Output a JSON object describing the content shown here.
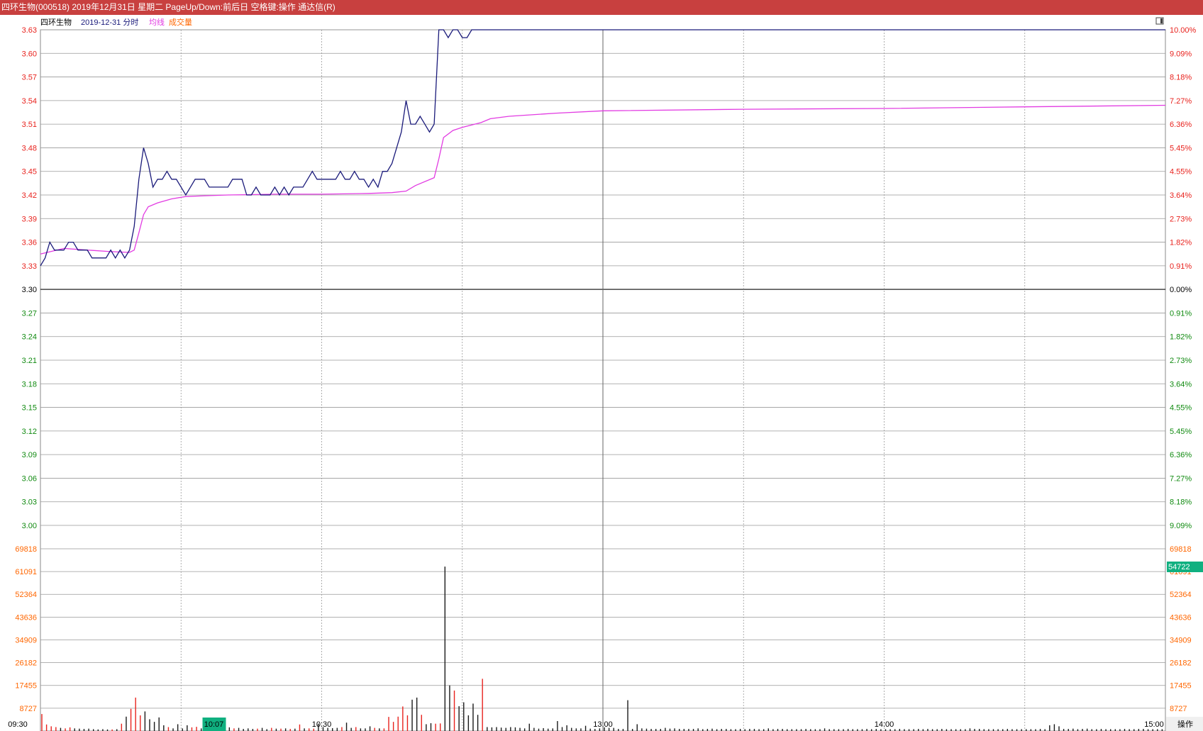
{
  "window": {
    "title": "四环生物(000518) 2019年12月31日 星期二 PageUp/Down:前后日 空格键:操作 通达信(R)"
  },
  "header": {
    "stock_name": "四环生物",
    "date_label": "2019-12-31 分时",
    "avg_label": "均线",
    "vol_label": "成交量"
  },
  "colors": {
    "up": "#e8221d",
    "down": "#108a10",
    "price_line": "#1a1a7a",
    "avg_line": "#e23be2",
    "volume_label": "#ff6600",
    "badge": "#10b080",
    "titlebar": "#c8403f"
  },
  "buttons": {
    "operate": "操作",
    "corner_icon": "window-toggle-icon"
  },
  "chart_data": {
    "type": "line",
    "title": "四环生物(000518) 2019-12-31 分时",
    "prev_close": 3.3,
    "price_axis": {
      "ylim": [
        3.0,
        3.63
      ],
      "ticks": [
        "3.63",
        "3.60",
        "3.57",
        "3.54",
        "3.51",
        "3.48",
        "3.45",
        "3.42",
        "3.39",
        "3.36",
        "3.33",
        "3.30",
        "3.27",
        "3.24",
        "3.21",
        "3.18",
        "3.15",
        "3.12",
        "3.09",
        "3.06",
        "3.03",
        "3.00"
      ],
      "pct_ticks": [
        "10.00%",
        "9.09%",
        "8.18%",
        "7.27%",
        "6.36%",
        "5.45%",
        "4.55%",
        "3.64%",
        "2.73%",
        "1.82%",
        "0.91%",
        "0.00%",
        "0.91%",
        "1.82%",
        "2.73%",
        "3.64%",
        "4.55%",
        "5.45%",
        "6.36%",
        "7.27%",
        "8.18%",
        "9.09%"
      ]
    },
    "volume_axis": {
      "ylim": [
        0,
        69818
      ],
      "ticks": [
        "69818",
        "61091",
        "52364",
        "43636",
        "34909",
        "26182",
        "17455",
        "8727"
      ],
      "highlight": "54722"
    },
    "x_axis": {
      "ticks": [
        "09:30",
        "10:30",
        "13:00",
        "14:00",
        "15:00"
      ],
      "cursor_label": "10:07"
    },
    "series": [
      {
        "name": "分时",
        "x": [
          0,
          1,
          2,
          3,
          4,
          5,
          6,
          7,
          8,
          9,
          10,
          11,
          12,
          13,
          14,
          15,
          16,
          17,
          18,
          19,
          20,
          21,
          22,
          23,
          24,
          25,
          26,
          27,
          28,
          29,
          30,
          31,
          32,
          33,
          34,
          35,
          36,
          37,
          38,
          39,
          40,
          41,
          42,
          43,
          44,
          45,
          46,
          47,
          48,
          49,
          50,
          51,
          52,
          53,
          54,
          55,
          56,
          57,
          58,
          59,
          60,
          61,
          62,
          63,
          64,
          65,
          66,
          67,
          68,
          69,
          70,
          71,
          72,
          73,
          74,
          75,
          76,
          77,
          78,
          79,
          80,
          81,
          82,
          83,
          84,
          85,
          86,
          87,
          88,
          89,
          90,
          91,
          92,
          93,
          94,
          95,
          96,
          97,
          98,
          99,
          100,
          101,
          240
        ],
        "values": [
          3.33,
          3.34,
          3.36,
          3.35,
          3.35,
          3.35,
          3.36,
          3.36,
          3.35,
          3.35,
          3.35,
          3.34,
          3.34,
          3.34,
          3.34,
          3.35,
          3.34,
          3.35,
          3.34,
          3.35,
          3.38,
          3.44,
          3.48,
          3.46,
          3.43,
          3.44,
          3.44,
          3.45,
          3.44,
          3.44,
          3.43,
          3.42,
          3.43,
          3.44,
          3.44,
          3.44,
          3.43,
          3.43,
          3.43,
          3.43,
          3.43,
          3.44,
          3.44,
          3.44,
          3.42,
          3.42,
          3.43,
          3.42,
          3.42,
          3.42,
          3.43,
          3.42,
          3.43,
          3.42,
          3.43,
          3.43,
          3.43,
          3.44,
          3.45,
          3.44,
          3.44,
          3.44,
          3.44,
          3.44,
          3.45,
          3.44,
          3.44,
          3.45,
          3.44,
          3.44,
          3.43,
          3.44,
          3.43,
          3.45,
          3.45,
          3.46,
          3.48,
          3.5,
          3.54,
          3.51,
          3.51,
          3.52,
          3.51,
          3.5,
          3.51,
          3.63,
          3.63,
          3.62,
          3.63,
          3.63,
          3.62,
          3.62,
          3.63,
          3.63,
          3.63,
          3.63,
          3.63,
          3.63,
          3.63,
          3.63,
          3.63,
          3.63,
          3.63
        ]
      },
      {
        "name": "均线",
        "x": [
          0,
          5,
          10,
          15,
          19,
          20,
          21,
          22,
          23,
          25,
          28,
          31,
          35,
          40,
          50,
          60,
          70,
          75,
          78,
          80,
          84,
          85,
          86,
          88,
          90,
          92,
          94,
          96,
          100,
          110,
          120,
          150,
          180,
          210,
          240
        ],
        "values": [
          3.345,
          3.352,
          3.35,
          3.348,
          3.347,
          3.35,
          3.372,
          3.395,
          3.405,
          3.41,
          3.415,
          3.418,
          3.419,
          3.42,
          3.421,
          3.421,
          3.422,
          3.423,
          3.425,
          3.432,
          3.442,
          3.466,
          3.493,
          3.502,
          3.506,
          3.509,
          3.512,
          3.517,
          3.52,
          3.524,
          3.527,
          3.529,
          3.53,
          3.532,
          3.534
        ]
      }
    ],
    "volume": {
      "x": [
        0,
        1,
        2,
        3,
        4,
        5,
        6,
        7,
        8,
        9,
        10,
        11,
        12,
        13,
        14,
        15,
        16,
        17,
        18,
        19,
        20,
        21,
        22,
        23,
        24,
        25,
        26,
        27,
        28,
        29,
        30,
        31,
        32,
        33,
        34,
        35,
        36,
        37,
        38,
        39,
        40,
        41,
        42,
        43,
        44,
        45,
        46,
        47,
        48,
        49,
        50,
        51,
        52,
        53,
        54,
        55,
        56,
        57,
        58,
        59,
        60,
        61,
        62,
        63,
        64,
        65,
        66,
        67,
        68,
        69,
        70,
        71,
        72,
        73,
        74,
        75,
        76,
        77,
        78,
        79,
        80,
        81,
        82,
        83,
        84,
        85,
        86,
        87,
        88,
        89,
        90,
        91,
        92,
        93,
        94,
        95,
        96,
        97,
        98,
        99,
        100,
        101,
        102,
        103,
        104,
        105,
        106,
        107,
        108,
        109,
        110,
        111,
        112,
        113,
        114,
        115,
        116,
        117,
        118,
        119,
        120,
        121,
        122,
        123,
        124,
        125,
        126,
        127,
        128,
        129,
        130,
        131,
        132,
        133,
        134,
        135,
        136,
        137,
        138,
        139,
        140,
        141,
        142,
        143,
        144,
        145,
        146,
        147,
        148,
        149,
        150,
        151,
        152,
        153,
        154,
        155,
        156,
        157,
        158,
        159,
        160,
        161,
        162,
        163,
        164,
        165,
        166,
        167,
        168,
        169,
        170,
        171,
        172,
        173,
        174,
        175,
        176,
        177,
        178,
        179,
        180,
        181,
        182,
        183,
        184,
        185,
        186,
        187,
        188,
        189,
        190,
        191,
        192,
        193,
        194,
        195,
        196,
        197,
        198,
        199,
        200,
        201,
        202,
        203,
        204,
        205,
        206,
        207,
        208,
        209,
        210,
        211,
        212,
        213,
        214,
        215,
        216,
        217,
        218,
        219,
        220,
        221,
        222,
        223,
        224,
        225,
        226,
        227,
        228,
        229,
        230,
        231,
        232,
        233,
        234,
        235,
        236,
        237,
        238,
        239
      ],
      "values": [
        6500,
        2500,
        1800,
        1500,
        1200,
        1000,
        1400,
        1000,
        900,
        800,
        900,
        700,
        600,
        700,
        600,
        600,
        700,
        2800,
        5500,
        8500,
        12800,
        6000,
        7500,
        4500,
        3500,
        5200,
        2200,
        1500,
        1000,
        2600,
        1000,
        2200,
        1400,
        1600,
        1000,
        1200,
        1000,
        800,
        1800,
        900,
        1400,
        1000,
        1200,
        800,
        1000,
        800,
        900,
        1200,
        700,
        1200,
        900,
        900,
        1000,
        800,
        900,
        2500,
        1000,
        1000,
        900,
        2800,
        1500,
        1200,
        1100,
        1200,
        1500,
        3200,
        1200,
        1500,
        1000,
        1000,
        1800,
        1200,
        1000,
        1000,
        5400,
        3500,
        5500,
        9400,
        6000,
        12000,
        12800,
        6200,
        2600,
        3000,
        2800,
        2900,
        63000,
        17500,
        15500,
        9500,
        11000,
        6000,
        10500,
        6200,
        20000,
        1500,
        1400,
        1500,
        1300,
        1200,
        1500,
        1400,
        1200,
        1000,
        2800,
        1200,
        900,
        1100,
        900,
        1000,
        3800,
        1500,
        2200,
        1200,
        1000,
        1000,
        2000,
        900,
        800,
        1000,
        1400,
        1200,
        1200,
        800,
        800,
        11800,
        800,
        2600,
        1000,
        900,
        800,
        800,
        800,
        1200,
        900,
        1000,
        800,
        800,
        800,
        800,
        1000,
        700,
        800,
        900,
        700,
        800,
        800,
        700,
        700,
        800,
        700,
        800,
        800,
        700,
        700,
        1000,
        700,
        800,
        800,
        700,
        700,
        700,
        700,
        800,
        700,
        700,
        700,
        1000,
        700,
        700,
        700,
        700,
        800,
        700,
        700,
        700,
        800,
        700,
        800,
        700,
        700,
        700,
        700,
        800,
        700,
        700,
        700,
        800,
        700,
        800,
        700,
        700,
        800,
        700,
        700,
        700,
        700,
        700,
        1000,
        800,
        800,
        700,
        700,
        700,
        700,
        700,
        800,
        700,
        700,
        700,
        700,
        700,
        700,
        800,
        700,
        2200,
        2600,
        1800,
        800,
        800,
        900,
        700,
        800,
        900,
        700,
        700,
        800,
        700,
        700,
        700,
        700,
        800,
        700,
        700,
        800,
        800,
        700,
        700,
        700,
        700,
        1800,
        2200,
        900,
        700,
        700,
        900,
        700,
        700,
        1500,
        2000,
        800
      ],
      "colors": [
        "up",
        "up",
        "up",
        "up",
        "dn",
        "up",
        "up",
        "dn",
        "dn",
        "dn",
        "dn",
        "dn",
        "dn",
        "dn",
        "dn",
        "up",
        "dn",
        "up",
        "dn",
        "up",
        "up",
        "up",
        "dn",
        "dn",
        "dn",
        "dn",
        "dn",
        "up",
        "dn",
        "dn",
        "dn",
        "dn",
        "up",
        "up",
        "dn",
        "dn",
        "dn",
        "dn",
        "up",
        "dn",
        "dn",
        "up",
        "dn",
        "dn",
        "dn",
        "dn",
        "up",
        "dn",
        "dn",
        "up",
        "dn",
        "up",
        "dn",
        "up",
        "dn",
        "up",
        "dn",
        "up",
        "up",
        "dn",
        "dn",
        "dn",
        "dn",
        "dn",
        "up",
        "dn",
        "dn",
        "up",
        "dn",
        "dn",
        "dn",
        "up",
        "dn",
        "up",
        "up",
        "up",
        "up",
        "up",
        "up",
        "dn",
        "dn",
        "up",
        "dn",
        "dn",
        "up",
        "up",
        "dn",
        "dn",
        "up",
        "dn",
        "dn",
        "dn",
        "dn",
        "dn",
        "up",
        "dn",
        "dn",
        "dn",
        "dn",
        "dn",
        "dn",
        "dn",
        "dn",
        "dn",
        "dn",
        "dn",
        "dn",
        "dn",
        "dn",
        "dn",
        "dn",
        "dn",
        "dn",
        "dn",
        "dn",
        "dn",
        "dn",
        "dn",
        "dn",
        "dn",
        "dn",
        "dn",
        "dn",
        "dn",
        "dn",
        "dn",
        "dn",
        "dn",
        "dn",
        "dn",
        "dn",
        "dn",
        "dn",
        "dn",
        "dn",
        "dn",
        "dn",
        "dn",
        "dn",
        "dn",
        "dn",
        "dn",
        "dn",
        "dn",
        "dn",
        "dn",
        "dn",
        "dn",
        "dn",
        "dn",
        "dn",
        "dn",
        "dn",
        "dn",
        "dn",
        "dn",
        "dn",
        "dn",
        "dn",
        "dn",
        "dn",
        "dn",
        "dn",
        "dn",
        "dn",
        "dn",
        "dn",
        "dn",
        "dn",
        "dn",
        "dn",
        "dn",
        "dn",
        "dn",
        "dn",
        "dn",
        "dn",
        "dn",
        "dn",
        "dn",
        "dn",
        "dn",
        "dn",
        "dn",
        "dn",
        "dn",
        "dn",
        "dn",
        "dn",
        "dn",
        "dn",
        "dn",
        "dn",
        "dn",
        "dn",
        "dn",
        "dn",
        "dn",
        "dn",
        "dn",
        "dn",
        "dn",
        "dn",
        "dn",
        "dn",
        "dn",
        "dn",
        "dn",
        "dn",
        "dn",
        "dn",
        "dn",
        "dn",
        "dn",
        "dn",
        "dn",
        "dn",
        "dn",
        "dn",
        "dn",
        "dn",
        "dn",
        "dn",
        "dn",
        "dn",
        "dn",
        "dn",
        "dn",
        "dn",
        "dn",
        "dn",
        "dn",
        "dn",
        "dn",
        "dn",
        "dn",
        "dn",
        "dn",
        "dn",
        "dn",
        "dn",
        "dn",
        "dn",
        "dn",
        "dn",
        "dn"
      ]
    }
  }
}
